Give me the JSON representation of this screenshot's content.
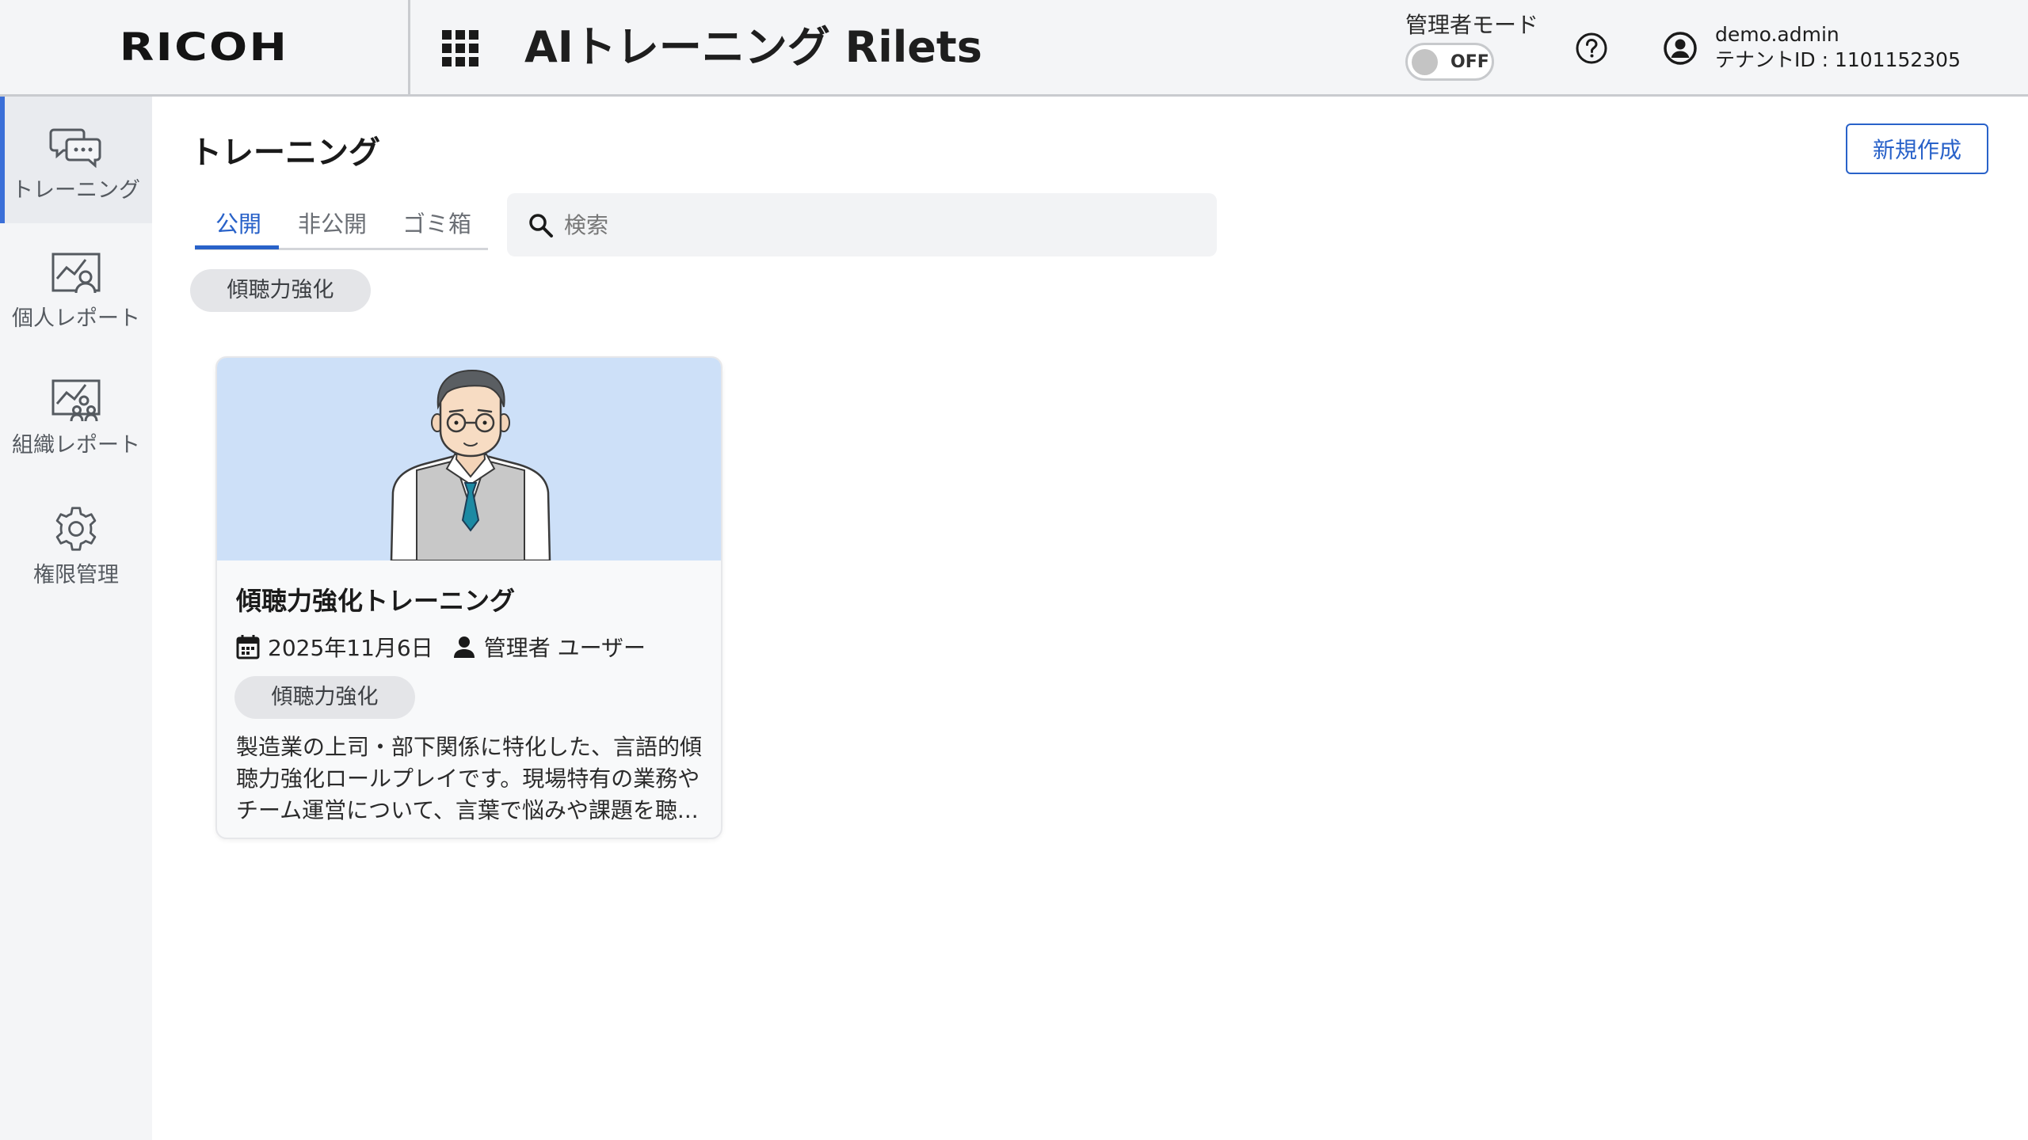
{
  "header": {
    "logo": "RICOH",
    "app_title": "AIトレーニング Rilets",
    "admin_mode_label": "管理者モード",
    "admin_toggle_state": "OFF",
    "user_name": "demo.admin",
    "tenant_id": "テナントID : 1101152305",
    "icons": [
      "apps-grid-icon",
      "help-icon",
      "account-icon"
    ]
  },
  "sidebar": {
    "items": [
      {
        "label": "トレーニング",
        "icon": "chat-bubbles-icon",
        "active": true
      },
      {
        "label": "個人レポート",
        "icon": "person-report-icon",
        "active": false
      },
      {
        "label": "組織レポート",
        "icon": "team-report-icon",
        "active": false
      },
      {
        "label": "権限管理",
        "icon": "gear-icon",
        "active": false
      }
    ]
  },
  "main": {
    "page_title": "トレーニング",
    "new_button": "新規作成",
    "tabs": [
      {
        "label": "公開",
        "active": true
      },
      {
        "label": "非公開",
        "active": false
      },
      {
        "label": "ゴミ箱",
        "active": false
      }
    ],
    "search": {
      "placeholder": "検索",
      "value": ""
    },
    "filter_chips": [
      "傾聴力強化"
    ]
  },
  "cards": [
    {
      "title": "傾聴力強化トレーニング",
      "date": "2025年11月6日",
      "author": "管理者 ユーザー",
      "tag": "傾聴力強化",
      "description": "製造業の上司・部下関係に特化した、言語的傾聴力強化ロールプレイです。現場特有の業務やチーム運営について、言葉で悩みや課題を聴..."
    }
  ],
  "colors": {
    "accent": "#2962c9",
    "header_bg": "#f4f5f7",
    "card_image_bg": "#cde0f8",
    "active_indicator": "#3b6fd8"
  }
}
